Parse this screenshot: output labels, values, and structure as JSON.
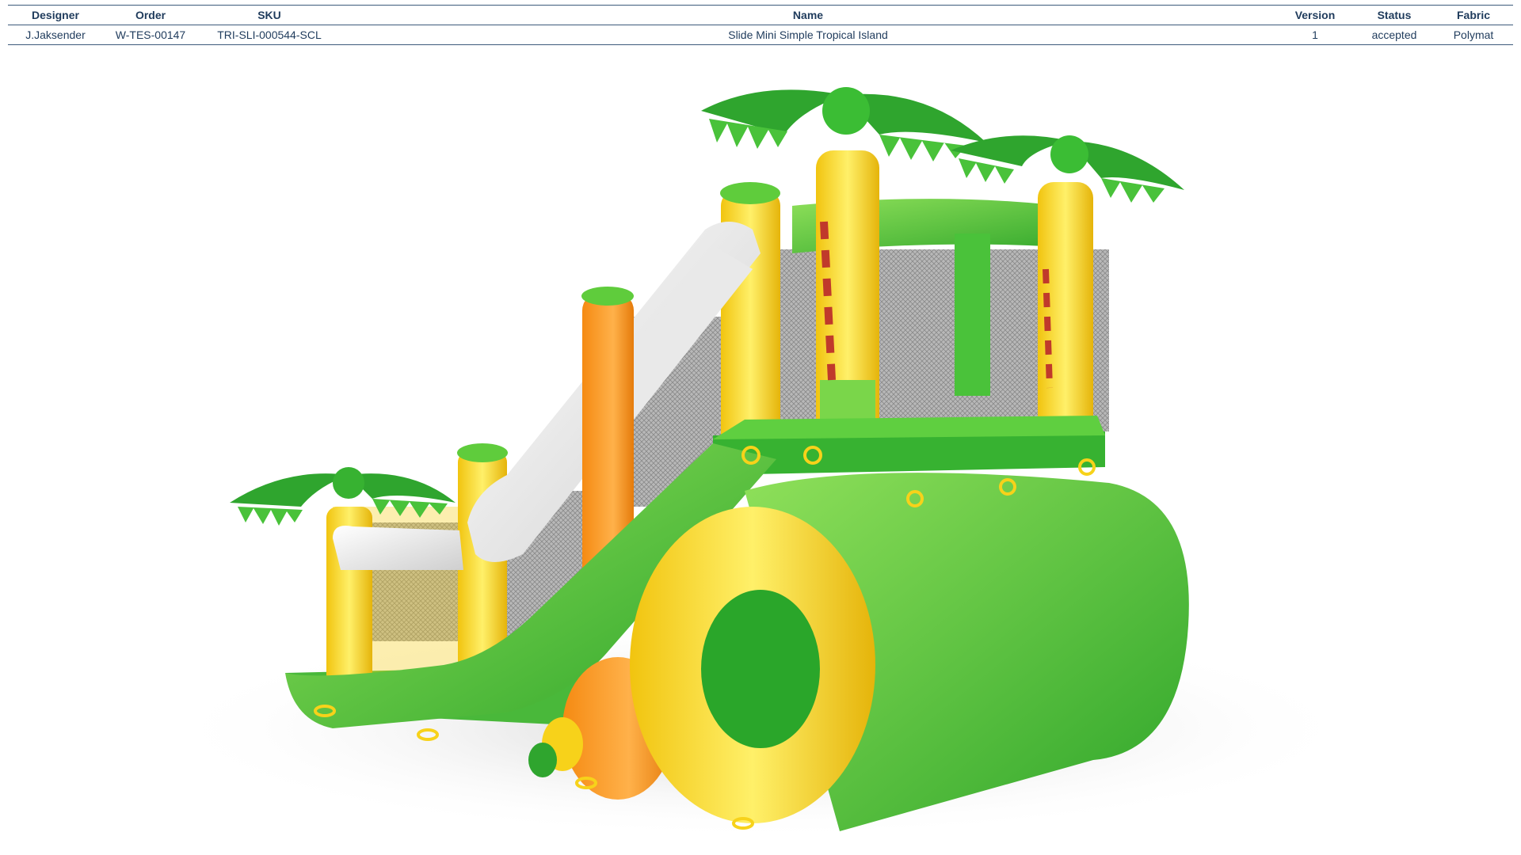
{
  "table": {
    "headers": {
      "designer": "Designer",
      "order": "Order",
      "sku": "SKU",
      "name": "Name",
      "version": "Version",
      "status": "Status",
      "fabric": "Fabric"
    },
    "row": {
      "designer": "J.Jaksender",
      "order": "W-TES-00147",
      "sku": "TRI-SLI-000544-SCL",
      "name": "Slide Mini Simple Tropical Island",
      "version": "1",
      "status": "accepted",
      "fabric": "Polymat"
    }
  },
  "render": {
    "subject": "inflatable-slide-tropical",
    "colors": {
      "green": "#3fb536",
      "light_green": "#7ad64a",
      "yellow": "#f7d21a",
      "orange": "#f7931e",
      "white": "#f2f2f2",
      "net": "#9a9a9a"
    }
  }
}
